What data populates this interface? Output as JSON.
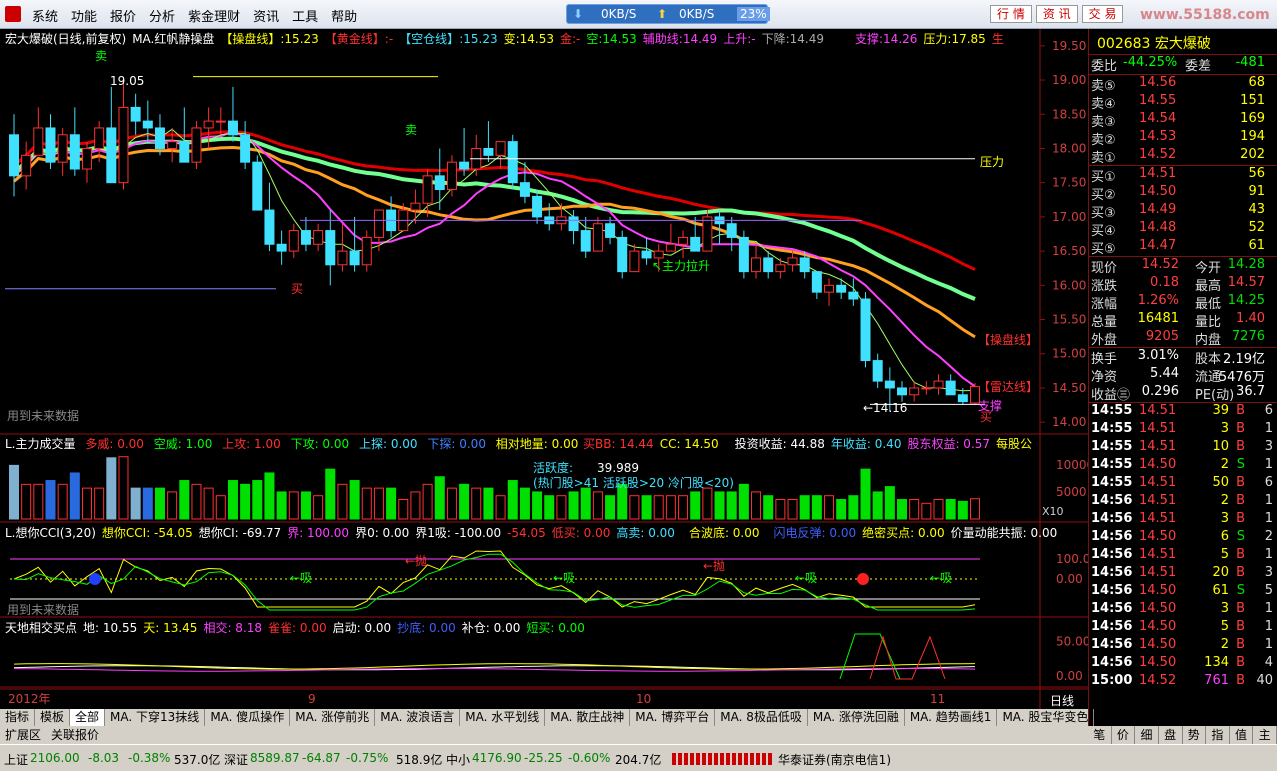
{
  "menu": {
    "items": [
      "系统",
      "功能",
      "报价",
      "分析",
      "紫金理财",
      "资讯",
      "工具",
      "帮助"
    ],
    "net_down": "0KB/S",
    "net_up": "0KB/S",
    "net_pct": "23%",
    "right_buttons": [
      "行 情",
      "资 讯",
      "交 易"
    ],
    "watermark": "www.55188.com"
  },
  "main_header": {
    "title": "宏大爆破(日线,前复权)",
    "ma_name": "MA.红帆静操盘",
    "cao": "【操盘线】",
    "cao_v": ":15.23",
    "huang": "【黄金线】",
    "huang_v": ":-",
    "kong": "【空仓线】",
    "kong_v": ":15.23",
    "bian": "变:14.53",
    "jin": "金:-",
    "kong2": "空:14.53",
    "fuzhu": "辅助线:14.49",
    "up": "上升:-",
    "down": "下降:14.49",
    "support": "支撑:14.26",
    "press": "压力:17.85",
    "sheng": "生"
  },
  "annotations": {
    "sell1": "卖",
    "high": "19.05",
    "sell2": "卖",
    "buy1": "买",
    "main_up": "↖主力拉升",
    "pressure": "压力",
    "cao_label": "【操盘线】",
    "radar_label": "【雷达线】",
    "support_label": "支撑",
    "buy2": "买",
    "low": "←14.16",
    "future1": "用到未来数据",
    "future2": "用到未来数据"
  },
  "y_axis_main": [
    "19.50",
    "19.00",
    "18.50",
    "18.00",
    "17.50",
    "17.00",
    "16.50",
    "16.00",
    "15.50",
    "15.00",
    "14.50",
    "14.00"
  ],
  "vol_header": {
    "name": "L.主力成交量",
    "duo": "多威: 0.00",
    "kong": "空威: 1.00",
    "up": "上攻: 1.00",
    "down": "下攻: 0.00",
    "probe_up": "上探: 0.00",
    "probe_down": "下探: 0.00",
    "rel": "相对地量: 0.00",
    "bb": "买BB: 14.44",
    "cc": "CC: 14.50",
    "invest": "投资收益: 44.88",
    "year": "年收益: 0.40",
    "equity": "股东权益: 0.57",
    "per": "每股公"
  },
  "activity": {
    "line1_label": "活跃度:",
    "line1_value": "39.989",
    "line2": "(热门股>41 活跃股>20 冷门股<20)"
  },
  "y_axis_vol": [
    "10000",
    "5000"
  ],
  "vol_x10": "X10",
  "cci_header": {
    "name": "L.想你CCI(3,20)",
    "cci": "想你CCI: -54.05",
    "ci": "想你CI: -69.77",
    "jie": "界: 100.00",
    "jie0": "界0: 0.00",
    "jie1": "界1吸: -100.00",
    "neg": "-54.05",
    "low_buy": "低买: 0.00",
    "high_sell": "高卖: 0.00",
    "he": "合波底: 0.00",
    "shan": "闪电反弹: 0.00",
    "jue": "绝密买点: 0.00",
    "gong": "价量动能共振: 0.00"
  },
  "cci_labels": {
    "pao1": "←抛",
    "xi1": "←吸",
    "pao2": "←抛",
    "xi2": "←吸",
    "xi3": "←吸",
    "xi4": "←吸"
  },
  "y_axis_cci": [
    "100.00",
    "0.00"
  ],
  "td_header": {
    "name": "天地相交买点",
    "di": "地: 10.55",
    "tian": "天: 13.45",
    "xiang": "相交: 8.18",
    "que": "雀雀: 0.00",
    "qi": "启动: 0.00",
    "di2": "抄底: 0.00",
    "bu": "补仓: 0.00",
    "duan": "短买: 0.00"
  },
  "y_axis_td": [
    "50.00",
    "0.00"
  ],
  "x_axis": {
    "year": "2012年",
    "m9": "9",
    "m10": "10",
    "m11": "11",
    "period": "日线"
  },
  "chart_controls": [
    "+",
    "-",
    "0"
  ],
  "tabs": [
    "指标",
    "模板",
    "全部",
    "MA. 下穿13抹线",
    "MA. 傻瓜操作",
    "MA. 涨停前兆",
    "MA. 波浪语言",
    "MA. 水平划线",
    "MA. 散庄战神",
    "MA. 博弈平台",
    "MA. 8极品低吸",
    "MA. 涨停洗回融",
    "MA. 趋势画线1",
    "MA. 股宝华变色"
  ],
  "tabs2": [
    "扩展区",
    "关联报价"
  ],
  "right_tabs": [
    "笔",
    "价",
    "细",
    "盘",
    "势",
    "指",
    "值",
    "主"
  ],
  "quote": {
    "code": "002683",
    "name": "宏大爆破",
    "weibi_label": "委比",
    "weibi": "-44.25%",
    "weicha_label": "委差",
    "weicha": "-481",
    "asks": [
      {
        "label": "卖⑤",
        "price": "14.56",
        "vol": "68"
      },
      {
        "label": "卖④",
        "price": "14.55",
        "vol": "151"
      },
      {
        "label": "卖③",
        "price": "14.54",
        "vol": "169"
      },
      {
        "label": "卖②",
        "price": "14.53",
        "vol": "194"
      },
      {
        "label": "卖①",
        "price": "14.52",
        "vol": "202"
      }
    ],
    "bids": [
      {
        "label": "买①",
        "price": "14.51",
        "vol": "56"
      },
      {
        "label": "买②",
        "price": "14.50",
        "vol": "91"
      },
      {
        "label": "买③",
        "price": "14.49",
        "vol": "43"
      },
      {
        "label": "买④",
        "price": "14.48",
        "vol": "52"
      },
      {
        "label": "买⑤",
        "price": "14.47",
        "vol": "61"
      }
    ],
    "stats": [
      {
        "l1": "现价",
        "v1": "14.52",
        "c1": "#ff4040",
        "l2": "今开",
        "v2": "14.28",
        "c2": "#00e000"
      },
      {
        "l1": "涨跌",
        "v1": "0.18",
        "c1": "#ff4040",
        "l2": "最高",
        "v2": "14.57",
        "c2": "#ff4040"
      },
      {
        "l1": "涨幅",
        "v1": "1.26%",
        "c1": "#ff4040",
        "l2": "最低",
        "v2": "14.25",
        "c2": "#00e000"
      },
      {
        "l1": "总量",
        "v1": "16481",
        "c1": "#ffff00",
        "l2": "量比",
        "v2": "1.40",
        "c2": "#ff4040"
      },
      {
        "l1": "外盘",
        "v1": "9205",
        "c1": "#ff4040",
        "l2": "内盘",
        "v2": "7276",
        "c2": "#00e000"
      }
    ],
    "stats2": [
      {
        "l1": "换手",
        "v1": "3.01%",
        "l2": "股本",
        "v2": "2.19亿"
      },
      {
        "l1": "净资",
        "v1": "5.44",
        "l2": "流通",
        "v2": "5476万"
      },
      {
        "l1": "收益㊂",
        "v1": "0.296",
        "l2": "PE(动)",
        "v2": "36.7"
      }
    ],
    "ticks": [
      {
        "t": "14:55",
        "p": "14.51",
        "v": "39",
        "s": "B",
        "n": "6"
      },
      {
        "t": "14:55",
        "p": "14.51",
        "v": "3",
        "s": "B",
        "n": "1"
      },
      {
        "t": "14:55",
        "p": "14.51",
        "v": "10",
        "s": "B",
        "n": "3"
      },
      {
        "t": "14:55",
        "p": "14.50",
        "v": "2",
        "s": "S",
        "n": "1"
      },
      {
        "t": "14:55",
        "p": "14.51",
        "v": "50",
        "s": "B",
        "n": "6"
      },
      {
        "t": "14:56",
        "p": "14.51",
        "v": "2",
        "s": "B",
        "n": "1"
      },
      {
        "t": "14:56",
        "p": "14.51",
        "v": "3",
        "s": "B",
        "n": "1"
      },
      {
        "t": "14:56",
        "p": "14.50",
        "v": "6",
        "s": "S",
        "n": "2"
      },
      {
        "t": "14:56",
        "p": "14.51",
        "v": "5",
        "s": "B",
        "n": "1"
      },
      {
        "t": "14:56",
        "p": "14.51",
        "v": "20",
        "s": "B",
        "n": "3"
      },
      {
        "t": "14:56",
        "p": "14.50",
        "v": "61",
        "s": "S",
        "n": "5"
      },
      {
        "t": "14:56",
        "p": "14.50",
        "v": "3",
        "s": "B",
        "n": "1"
      },
      {
        "t": "14:56",
        "p": "14.50",
        "v": "5",
        "s": "B",
        "n": "1"
      },
      {
        "t": "14:56",
        "p": "14.50",
        "v": "2",
        "s": "B",
        "n": "1"
      },
      {
        "t": "14:56",
        "p": "14.50",
        "v": "134",
        "s": "B",
        "n": "4"
      },
      {
        "t": "15:00",
        "p": "14.52",
        "v": "761",
        "s": "B",
        "n": "40"
      }
    ]
  },
  "status": {
    "sh_label": "上证",
    "sh": "2106.00",
    "sh_chg": "-8.03",
    "sh_pct": "-0.38%",
    "sh_amt": "537.0亿",
    "sz_label": "深证",
    "sz": "8589.87",
    "sz_chg": "-64.87",
    "sz_pct": "-0.75%",
    "sz_amt": "518.9亿",
    "zx_label": "中小",
    "zx": "4176.90",
    "zx_chg": "-25.25",
    "zx_pct": "-0.60%",
    "zx_amt": "204.7亿",
    "broker": "华泰证券(南京电信1)"
  },
  "chart_data": {
    "type": "candlestick",
    "title": "宏大爆破(日线,前复权)",
    "x": [
      "2012-08",
      "2012-09",
      "2012-10",
      "2012-11"
    ],
    "candles": [
      [
        18.2,
        18.5,
        17.3,
        17.6
      ],
      [
        17.6,
        18.1,
        17.4,
        17.9
      ],
      [
        17.9,
        18.6,
        17.9,
        18.3
      ],
      [
        18.3,
        18.5,
        17.7,
        17.8
      ],
      [
        17.8,
        18.3,
        17.6,
        18.2
      ],
      [
        18.2,
        18.6,
        17.6,
        17.7
      ],
      [
        17.7,
        18.1,
        17.5,
        18.0
      ],
      [
        18.0,
        18.4,
        17.8,
        18.3
      ],
      [
        18.3,
        18.9,
        17.5,
        17.5
      ],
      [
        17.5,
        19.05,
        17.4,
        18.6
      ],
      [
        18.6,
        18.8,
        18.2,
        18.4
      ],
      [
        18.4,
        18.7,
        18.1,
        18.3
      ],
      [
        18.3,
        18.5,
        17.9,
        18.0
      ],
      [
        18.0,
        18.3,
        17.8,
        18.1
      ],
      [
        18.1,
        18.6,
        17.8,
        17.8
      ],
      [
        17.8,
        18.4,
        17.7,
        18.3
      ],
      [
        18.3,
        18.6,
        18.0,
        18.4
      ],
      [
        18.4,
        18.6,
        18.2,
        18.4
      ],
      [
        18.4,
        18.9,
        18.1,
        18.2
      ],
      [
        18.2,
        18.4,
        17.7,
        17.8
      ],
      [
        17.8,
        17.9,
        17.1,
        17.1
      ],
      [
        17.1,
        17.5,
        16.5,
        16.6
      ],
      [
        16.6,
        16.8,
        16.3,
        16.5
      ],
      [
        16.5,
        16.9,
        16.4,
        16.8
      ],
      [
        16.8,
        17.0,
        16.5,
        16.6
      ],
      [
        16.6,
        16.9,
        16.5,
        16.8
      ],
      [
        16.8,
        17.1,
        16.0,
        16.3
      ],
      [
        16.3,
        16.9,
        16.2,
        16.5
      ],
      [
        16.5,
        17.0,
        16.2,
        16.3
      ],
      [
        16.3,
        16.8,
        16.2,
        16.7
      ],
      [
        16.7,
        17.1,
        16.5,
        17.1
      ],
      [
        17.1,
        17.3,
        16.7,
        16.8
      ],
      [
        16.8,
        17.2,
        16.9,
        17.1
      ],
      [
        17.1,
        17.4,
        16.9,
        17.2
      ],
      [
        17.2,
        17.7,
        17.0,
        17.6
      ],
      [
        17.6,
        18.0,
        17.1,
        17.4
      ],
      [
        17.4,
        17.9,
        17.3,
        17.8
      ],
      [
        17.8,
        18.3,
        17.6,
        17.7
      ],
      [
        17.7,
        18.2,
        17.6,
        18.0
      ],
      [
        18.0,
        18.4,
        17.8,
        17.9
      ],
      [
        17.9,
        18.1,
        17.7,
        18.1
      ],
      [
        18.1,
        18.2,
        17.4,
        17.5
      ],
      [
        17.5,
        17.8,
        17.2,
        17.3
      ],
      [
        17.3,
        17.4,
        16.9,
        17.0
      ],
      [
        17.0,
        17.2,
        16.8,
        16.9
      ],
      [
        16.9,
        17.2,
        16.8,
        17.0
      ],
      [
        17.0,
        17.1,
        16.6,
        16.8
      ],
      [
        16.8,
        17.0,
        16.4,
        16.5
      ],
      [
        16.5,
        17.0,
        16.5,
        16.9
      ],
      [
        16.9,
        17.0,
        16.6,
        16.7
      ],
      [
        16.7,
        16.8,
        16.1,
        16.2
      ],
      [
        16.2,
        16.6,
        16.2,
        16.5
      ],
      [
        16.5,
        16.7,
        16.3,
        16.4
      ],
      [
        16.4,
        16.6,
        16.2,
        16.5
      ],
      [
        16.5,
        16.9,
        16.5,
        16.6
      ],
      [
        16.6,
        16.8,
        16.4,
        16.7
      ],
      [
        16.7,
        17.0,
        16.5,
        16.5
      ],
      [
        16.5,
        17.1,
        16.5,
        17.0
      ],
      [
        17.0,
        17.1,
        16.6,
        16.9
      ],
      [
        16.9,
        17.0,
        16.5,
        16.7
      ],
      [
        16.7,
        16.8,
        16.1,
        16.2
      ],
      [
        16.2,
        16.6,
        16.1,
        16.4
      ],
      [
        16.4,
        16.5,
        16.1,
        16.2
      ],
      [
        16.2,
        16.4,
        16.1,
        16.3
      ],
      [
        16.3,
        16.5,
        16.2,
        16.4
      ],
      [
        16.4,
        16.5,
        16.1,
        16.2
      ],
      [
        16.2,
        16.2,
        15.8,
        15.9
      ],
      [
        15.9,
        16.1,
        15.7,
        16.0
      ],
      [
        16.0,
        16.1,
        15.8,
        15.9
      ],
      [
        15.9,
        16.1,
        15.7,
        15.8
      ],
      [
        15.8,
        15.9,
        14.8,
        14.9
      ],
      [
        14.9,
        15.0,
        14.5,
        14.6
      ],
      [
        14.6,
        14.8,
        14.16,
        14.5
      ],
      [
        14.5,
        14.6,
        14.3,
        14.4
      ],
      [
        14.4,
        14.6,
        14.3,
        14.5
      ],
      [
        14.5,
        14.6,
        14.4,
        14.5
      ],
      [
        14.5,
        14.7,
        14.4,
        14.6
      ],
      [
        14.6,
        14.7,
        14.4,
        14.4
      ],
      [
        14.4,
        14.5,
        14.25,
        14.3
      ],
      [
        14.28,
        14.57,
        14.25,
        14.52
      ]
    ],
    "ma_operate_last": 15.23,
    "support": 14.26,
    "pressure": 17.85,
    "ylim": [
      13.9,
      19.6
    ]
  }
}
